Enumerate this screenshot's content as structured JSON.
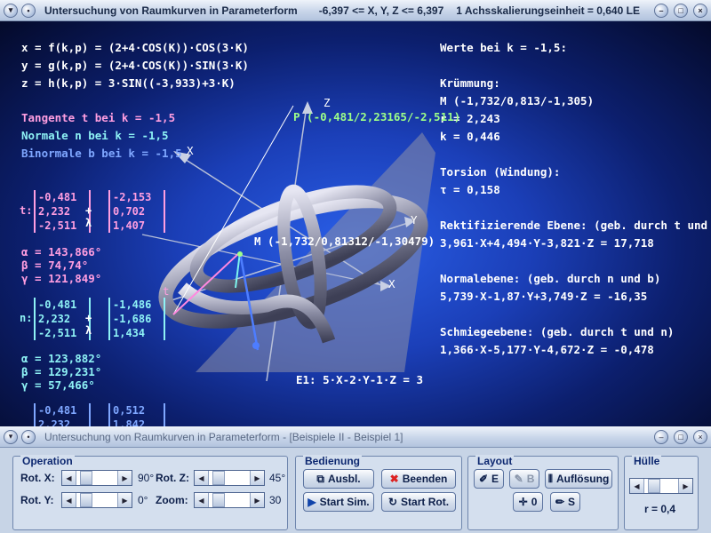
{
  "window_top": {
    "title": "Untersuchung von Raumkurven in Parameterform",
    "range": "-6,397 <= X, Y, Z <= 6,397",
    "scale": "1 Achsskalierungseinheit = 0,640 LE"
  },
  "window_bottom": {
    "title": "Untersuchung von Raumkurven in Parameterform - [Beispiele II - Beispiel 1]"
  },
  "equations": {
    "x": "x = f(k,p) = (2+4·COS(K))·COS(3·K)",
    "y": "y = g(k,p) = (2+4·COS(K))·SIN(3·K)",
    "z": "z = h(k,p) = 3·SIN((-3,933)+3·K)"
  },
  "legend": {
    "tangent": "Tangente t bei k = -1,5",
    "normal": "Normale n bei k = -1,5",
    "binormal": "Binormale b bei k = -1,5"
  },
  "tangent_vec": {
    "prefix": "t:",
    "base": [
      "-0,481",
      "2,232",
      "-2,511"
    ],
    "op": "+ λ",
    "dir": [
      "-2,153",
      "0,702",
      "1,407"
    ]
  },
  "tangent_angles": {
    "alpha": "α = 143,866°",
    "beta": "β = 74,74°",
    "gamma": "γ = 121,849°"
  },
  "normal_vec": {
    "prefix": "n:",
    "base": [
      "-0,481",
      "2,232",
      "-2,511"
    ],
    "op": "+ λ",
    "dir": [
      "-1,486",
      "-1,686",
      "1,434"
    ]
  },
  "normal_angles": {
    "alpha": "α = 123,882°",
    "beta": "β = 129,231°",
    "gamma": "γ = 57,466°"
  },
  "binormal_vec": {
    "prefix": "b:",
    "base": [
      "-0,481",
      "2,232"
    ],
    "dir": [
      "0,512",
      "1,842"
    ]
  },
  "values": {
    "header": "Werte bei k = -1,5:",
    "curvature_title": "Krümmung:",
    "M": "M (-1,732/0,813/-1,305)",
    "r": "r = 2,243",
    "k": "k = 0,446",
    "torsion_title": "Torsion (Windung):",
    "tau": "τ = 0,158",
    "rect_title": "Rektifizierende Ebene: (geb. durch t und b)",
    "rect_eq": "3,961·X+4,494·Y-3,821·Z = 17,718",
    "normal_title": "Normalebene: (geb. durch n und b)",
    "normal_eq": "5,739·X-1,87·Y+3,749·Z = -16,35",
    "osc_title": "Schmiegeebene: (geb. durch t und n)",
    "osc_eq": "1,366·X-5,177·Y-4,672·Z = -0,478"
  },
  "scene": {
    "point_P": "P (-0,481/2,23165/-2,511)",
    "point_M": "M (-1,732/0,81312/-1,30479)",
    "plane": "E1: 5·X-2·Y-1·Z = 3",
    "axis_labels": {
      "x1": "X",
      "x2": "X",
      "y": "Y",
      "z": "Z",
      "t": "t"
    }
  },
  "panel": {
    "operation": {
      "title": "Operation",
      "rot_x_label": "Rot. X:",
      "rot_x_value": "90°",
      "rot_y_label": "Rot. Y:",
      "rot_y_value": "0°",
      "rot_z_label": "Rot. Z:",
      "rot_z_value": "45°",
      "zoom_label": "Zoom:",
      "zoom_value": "30"
    },
    "bedienung": {
      "title": "Bedienung",
      "ausbl": "Ausbl.",
      "beenden": "Beenden",
      "start_sim": "Start Sim.",
      "start_rot": "Start Rot."
    },
    "layout": {
      "title": "Layout",
      "e": "E",
      "b": "B",
      "aufloesung": "Auflösung",
      "zero": "0",
      "s": "S"
    },
    "huelle": {
      "title": "Hülle",
      "r": "r = 0,4"
    }
  }
}
